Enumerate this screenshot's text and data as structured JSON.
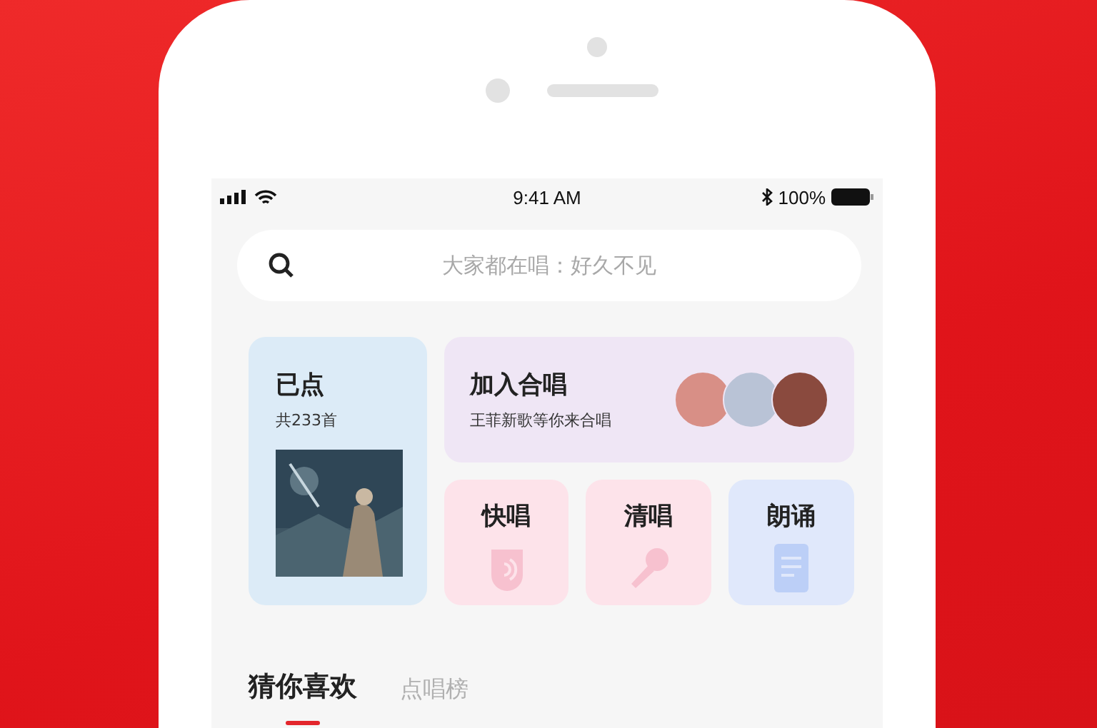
{
  "status_bar": {
    "time": "9:41 AM",
    "battery": "100%"
  },
  "search": {
    "placeholder": "大家都在唱：好久不见"
  },
  "ordered": {
    "title": "已点",
    "count": "共233首"
  },
  "chorus": {
    "title": "加入合唱",
    "subtitle": "王菲新歌等你来合唱"
  },
  "modes": [
    {
      "label": "快唱",
      "kind": "quick"
    },
    {
      "label": "清唱",
      "kind": "acapella"
    },
    {
      "label": "朗诵",
      "kind": "recite"
    }
  ],
  "tabs": [
    {
      "label": "猜你喜欢",
      "selected": true
    },
    {
      "label": "点唱榜",
      "selected": false
    }
  ]
}
